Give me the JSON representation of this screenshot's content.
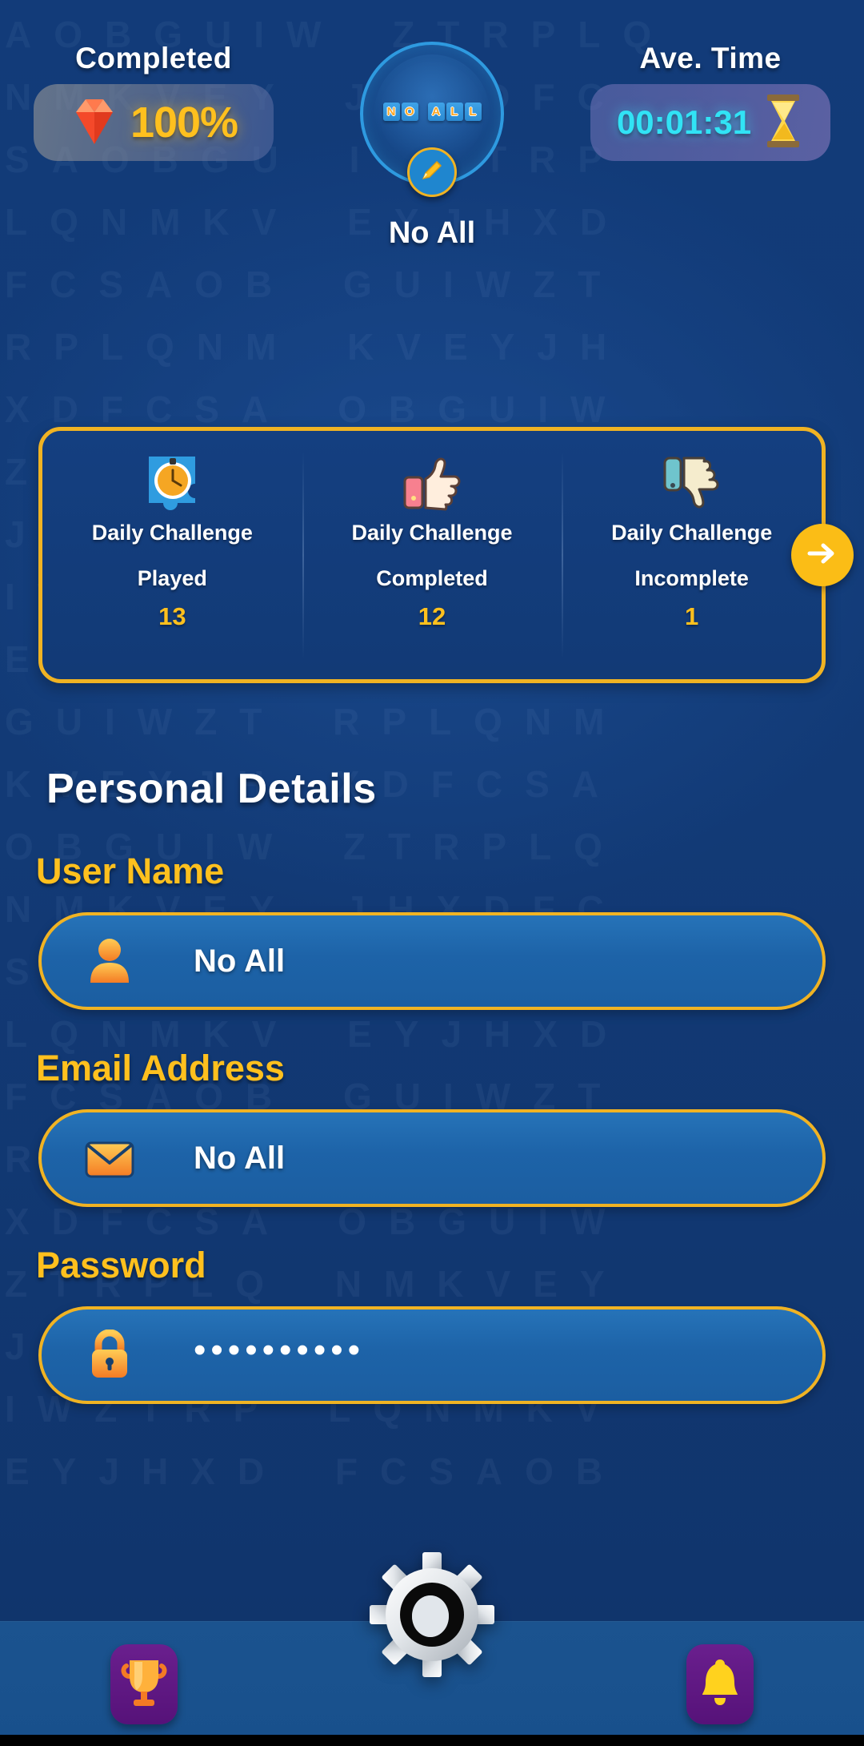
{
  "top": {
    "completed": {
      "caption": "Completed",
      "value": "100%",
      "icon": "gem-icon"
    },
    "avatar": {
      "name_tiles": [
        "N",
        "O",
        "A",
        "L",
        "L"
      ],
      "username": "No All",
      "edit_icon": "pencil-icon"
    },
    "ave_time": {
      "caption": "Ave. Time",
      "value": "00:01:31",
      "icon": "hourglass-icon"
    }
  },
  "stats_card": {
    "columns": [
      {
        "icon": "stopwatch-puzzle-icon",
        "title": "Daily Challenge",
        "subtitle": "Played",
        "value": "13"
      },
      {
        "icon": "thumbs-up-icon",
        "title": "Daily Challenge",
        "subtitle": "Completed",
        "value": "12"
      },
      {
        "icon": "thumbs-down-icon",
        "title": "Daily Challenge",
        "subtitle": "Incomplete",
        "value": "1"
      }
    ],
    "next_label": "→"
  },
  "details": {
    "section_title": "Personal Details",
    "fields": [
      {
        "label": "User Name",
        "icon": "person-icon",
        "value": "No All"
      },
      {
        "label": "Email Address",
        "icon": "envelope-icon",
        "value": "No All"
      },
      {
        "label": "Password",
        "icon": "lock-icon",
        "value": "••••••••••"
      }
    ]
  },
  "bottom_nav": {
    "items": [
      {
        "icon": "trophy-icon"
      },
      {
        "icon": "gear-icon"
      },
      {
        "icon": "bell-icon"
      }
    ]
  },
  "colors": {
    "background": "#123a76",
    "accent_yellow": "#f0b323",
    "value_yellow": "#ffc01e",
    "time_cyan": "#31e3f5",
    "field_blue": "#1d63a8",
    "nav_purple": "#6a1f8e"
  },
  "bg_texture_text": "AOBGUIW ZTRPLQ NMKVEY JHXDFC SAOBGU IWZTRP LQNMKV EYJHXD FCSAOB GUIWZT RPLQNM KVEYJH XDFCSA OBGUIW ZTRPLQ NMKVEY JHXDFC SAOBGU IWZTRP LQNMKV EYJHXD FCSAOB GUIWZT RPLQNM KVEYJH XDFCSA OBGUIW ZTRPLQ NMKVEY JHXDFC SAOBGU IWZTRP LQNMKV EYJHXD FCSAOB GUIWZT RPLQNM KVEYJH XDFCSA OBGUIW ZTRPLQ NMKVEY JHXDFC SAOBGU IWZTRP LQNMKV EYJHXD FCSAOB"
}
